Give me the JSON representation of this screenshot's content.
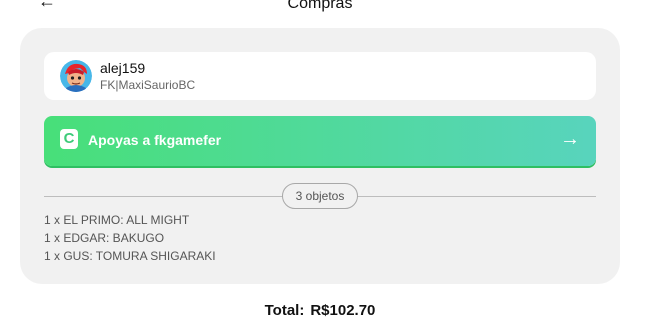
{
  "header": {
    "title": "Compras",
    "back_icon": "arrow-left-icon"
  },
  "creator": {
    "username": "alej159",
    "handle": "FK|MaxiSaurioBC",
    "avatar_icon": "avatar-icon"
  },
  "support": {
    "label": "Apoyas a fkgamefer",
    "logo_letter": "C",
    "arrow_icon": "arrow-right-icon",
    "colors": {
      "start": "#48df79",
      "end": "#58d4bd"
    }
  },
  "order": {
    "count_label": "3 objetos",
    "items": [
      "1 x EL PRIMO: ALL MIGHT",
      "1 x EDGAR: BAKUGO",
      "1 x GUS: TOMURA SHIGARAKI"
    ]
  },
  "total": {
    "label": "Total:",
    "amount": "R$102.70"
  }
}
